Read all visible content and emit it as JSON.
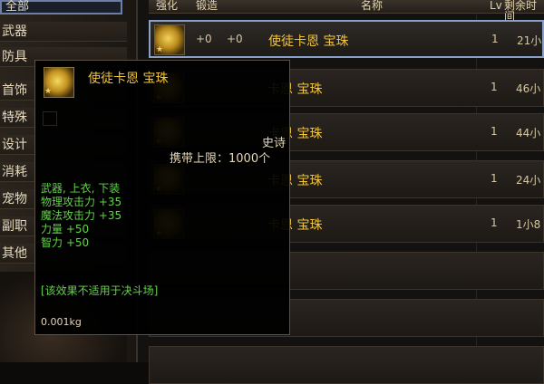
{
  "sidebar": {
    "top_label": "全部",
    "categories": [
      "武器",
      "防具",
      "首饰",
      "特殊",
      "设计",
      "消耗",
      "宠物",
      "副职",
      "其他"
    ]
  },
  "table": {
    "headers": [
      "强化",
      "锻造",
      "名称",
      "Lv",
      "剩余时间"
    ],
    "rows": [
      {
        "plus1": "+0",
        "plus2": "+0",
        "name": "使徒卡恩 宝珠",
        "lvl": "1",
        "price": "21小"
      },
      {
        "plus1": "",
        "plus2": "",
        "name": "卡恩 宝珠",
        "lvl": "1",
        "price": "46小"
      },
      {
        "plus1": "",
        "plus2": "",
        "name": "卡恩 宝珠",
        "lvl": "1",
        "price": "44小"
      },
      {
        "plus1": "",
        "plus2": "",
        "name": "卡恩 宝珠",
        "lvl": "1",
        "price": "24小"
      },
      {
        "plus1": "",
        "plus2": "",
        "name": "卡恩 宝珠",
        "lvl": "1",
        "price": "1小8"
      }
    ]
  },
  "tooltip": {
    "title": "使徒卡恩 宝珠",
    "grade": "史诗",
    "carry_limit": "携带上限：1000个",
    "stats": [
      "武器, 上衣, 下装",
      "物理攻击力 +35",
      "魔法攻击力 +35",
      "力量 +50",
      "智力 +50"
    ],
    "note": "[该效果不适用于决斗场]",
    "weight": "0.001kg"
  },
  "colors": {
    "item_name": "#f0c33a",
    "stat_text": "#63d24a",
    "selected_border": "#8aa0c8"
  },
  "icons": {
    "item": "gold-orb-icon",
    "rarity": "star-icon"
  }
}
